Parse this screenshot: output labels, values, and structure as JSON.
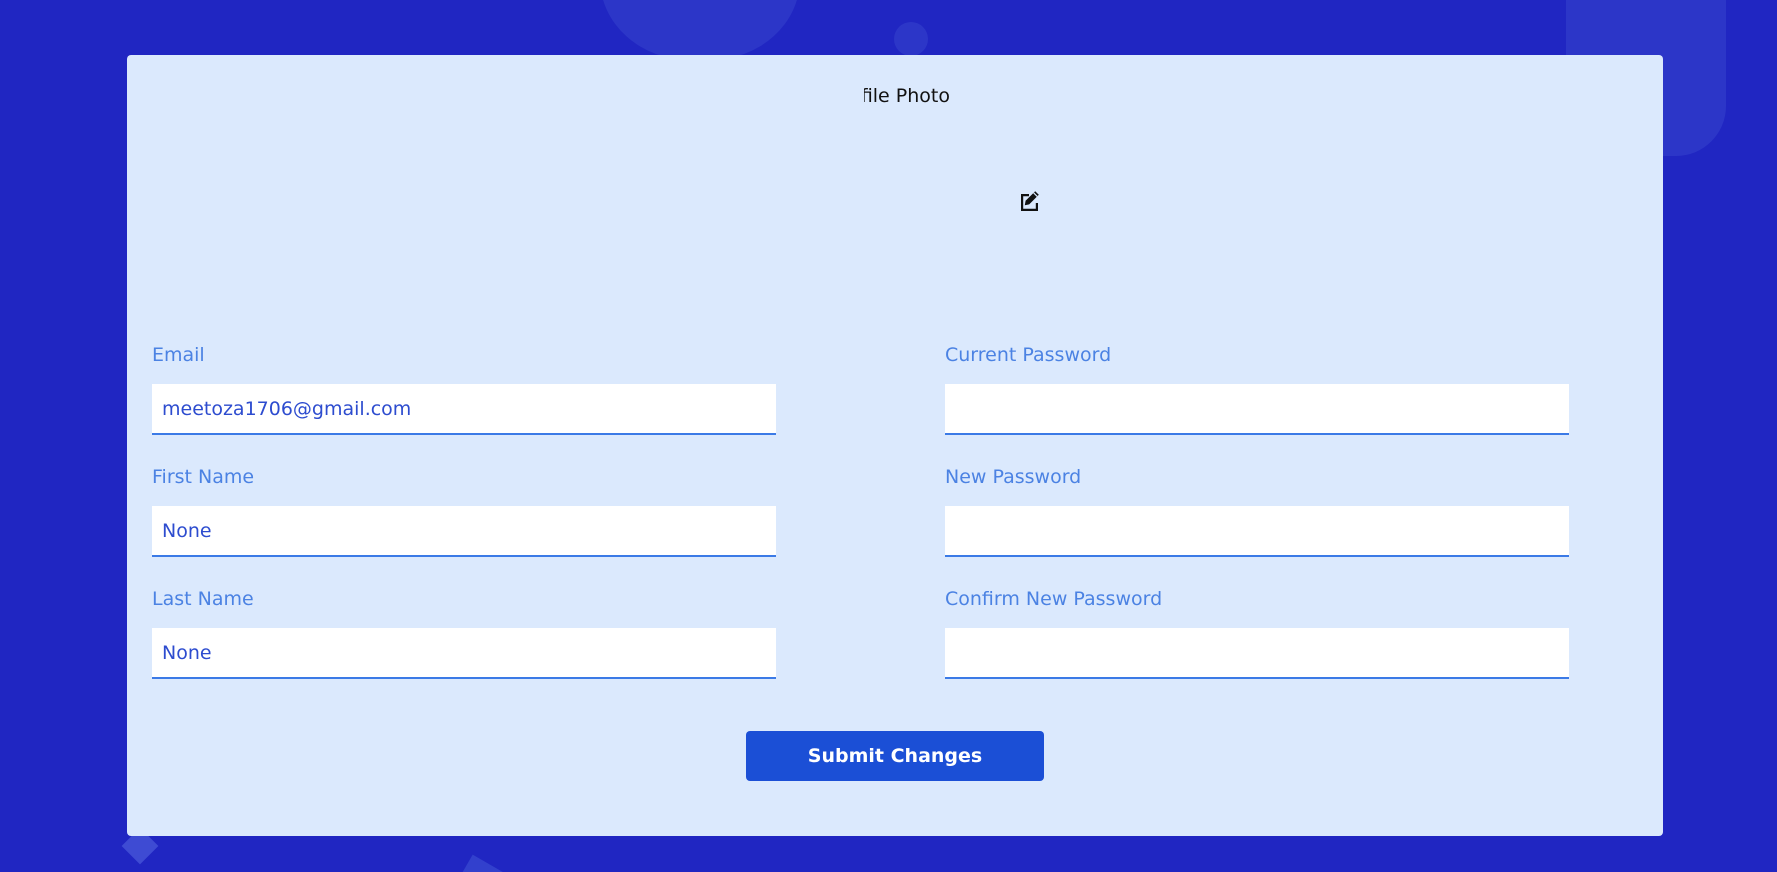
{
  "profile": {
    "photo_label": "Profile Photo",
    "edit_icon": "edit-pencil-square-icon"
  },
  "form": {
    "email": {
      "label": "Email",
      "value": "meetoza1706@gmail.com"
    },
    "first_name": {
      "label": "First Name",
      "value": "None"
    },
    "last_name": {
      "label": "Last Name",
      "value": "None"
    },
    "current_password": {
      "label": "Current Password",
      "value": ""
    },
    "new_password": {
      "label": "New Password",
      "value": ""
    },
    "confirm_new_password": {
      "label": "Confirm New Password",
      "value": ""
    },
    "submit_label": "Submit Changes"
  },
  "colors": {
    "page_background": "#2026c2",
    "card_background": "#dbe9fd",
    "label_text": "#4b82e3",
    "input_text": "#2d4ccf",
    "input_underline": "#3b7ae6",
    "button_background": "#1b4fd6"
  }
}
